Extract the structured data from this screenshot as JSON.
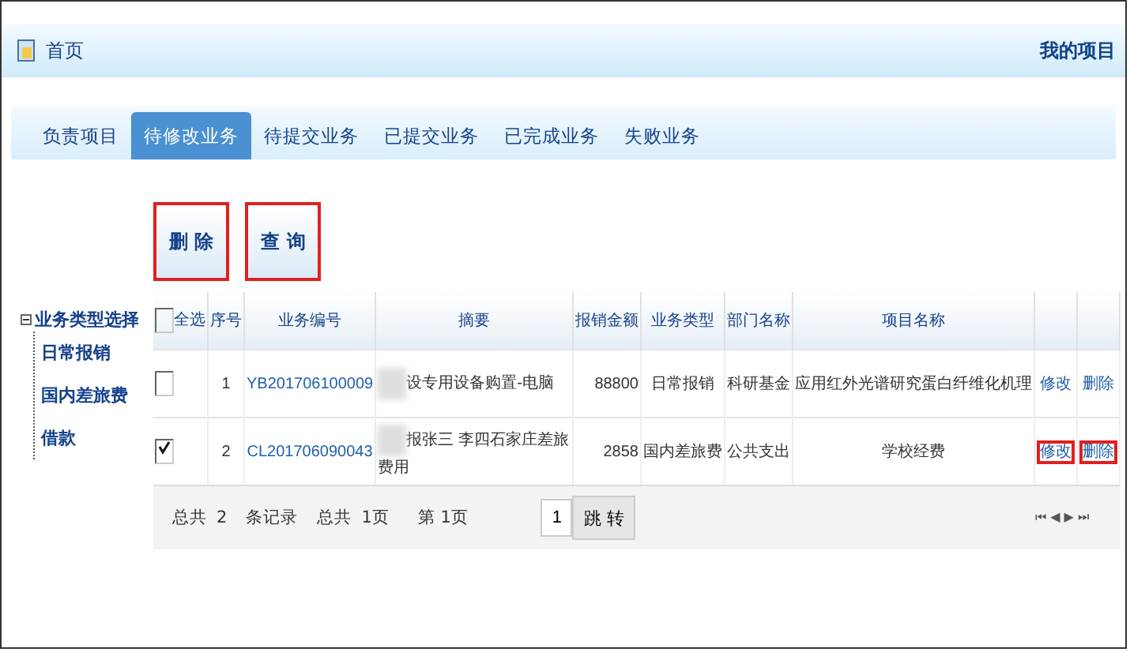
{
  "header": {
    "title": "首页",
    "link": "我的项目"
  },
  "tabs": [
    {
      "label": "负责项目",
      "selected": false
    },
    {
      "label": "待修改业务",
      "selected": true
    },
    {
      "label": "待提交业务",
      "selected": false
    },
    {
      "label": "已提交业务",
      "selected": false
    },
    {
      "label": "已完成业务",
      "selected": false
    },
    {
      "label": "失败业务",
      "selected": false
    }
  ],
  "actions": [
    {
      "label": "删 除",
      "highlighted": true
    },
    {
      "label": "查 询",
      "highlighted": true
    }
  ],
  "tree": {
    "label": "业务类型选择",
    "expanded": true,
    "children": [
      {
        "label": "日常报销"
      },
      {
        "label": "国内差旅费"
      },
      {
        "label": "借款"
      }
    ]
  },
  "table": {
    "select_all": {
      "label": "全选",
      "checked": false
    },
    "columns": [
      "序号",
      "业务编号",
      "摘要",
      "报销金额",
      "业务类型",
      "部门名称",
      "项目名称"
    ],
    "rows": [
      {
        "checked": false,
        "cells": [
          "1",
          "YB201706100009",
          "设专用设备购置-电脑",
          "88800",
          "日常报销",
          "科研基金",
          "应用红外光谱研究蛋白纤维化机理"
        ],
        "edit": {
          "label": "修改",
          "highlighted": false
        },
        "delete": {
          "label": "删除",
          "highlighted": false
        }
      },
      {
        "checked": true,
        "cells": [
          "2",
          "CL201706090043",
          "报张三 李四石家庄差旅费用",
          "2858",
          "国内差旅费",
          "公共支出",
          "学校经费"
        ],
        "edit": {
          "label": "修改",
          "highlighted": true
        },
        "delete": {
          "label": "删除",
          "highlighted": true
        }
      }
    ]
  },
  "pager": {
    "total_label": "总共",
    "total": "2",
    "records": "条记录",
    "pages_label": "总共",
    "pages": "1页",
    "current": "第 1页",
    "page_input": "1",
    "go": "跳 转",
    "nav": "⏮ ◀ ▶ ⏭"
  }
}
